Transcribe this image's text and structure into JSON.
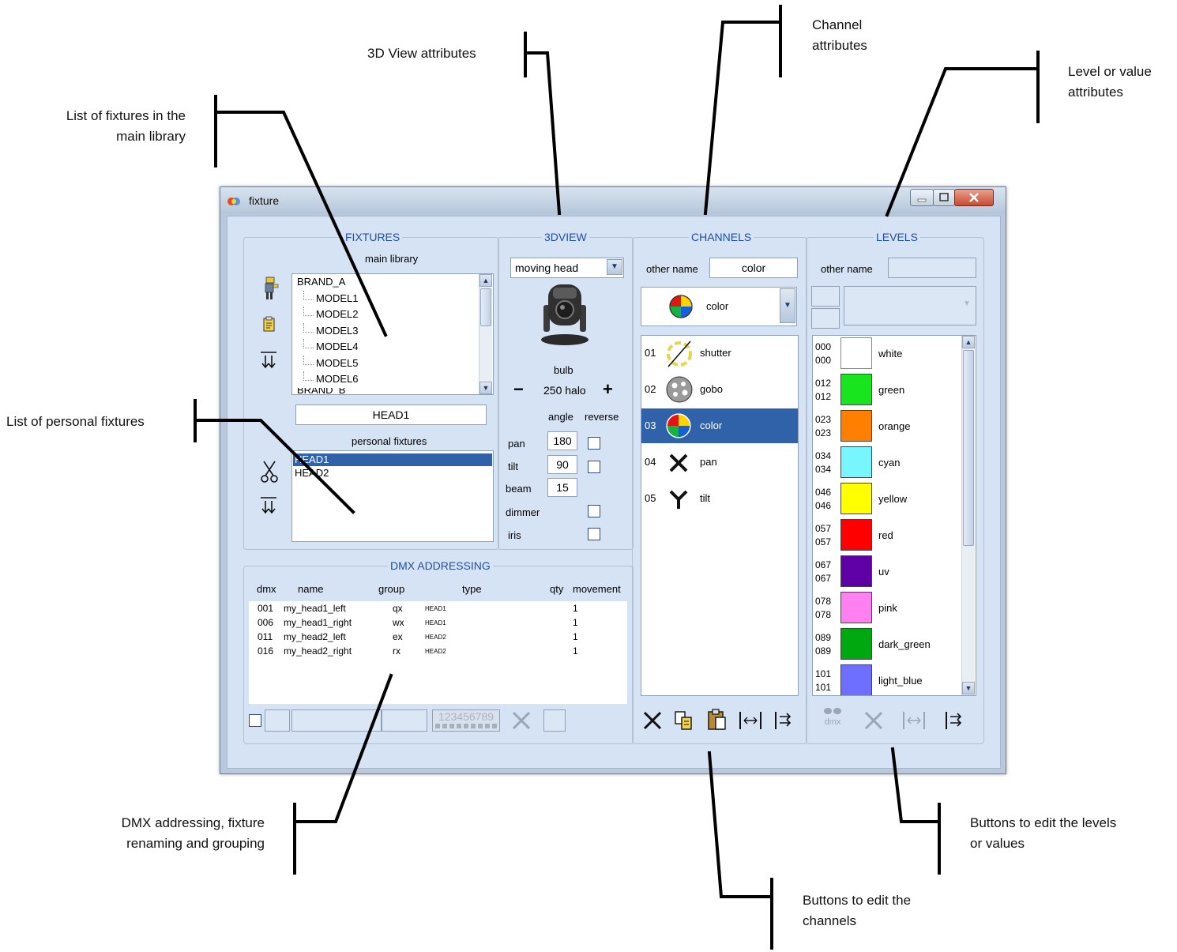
{
  "callouts": {
    "view3d": "3D View attributes",
    "channel": [
      "Channel",
      "attributes"
    ],
    "level": [
      "Level or value",
      "attributes"
    ],
    "main_library": [
      "List of fixtures in the",
      "main library"
    ],
    "personal": "List of personal fixtures",
    "dmx": [
      "DMX addressing, fixture",
      "renaming and grouping"
    ],
    "edit_levels": [
      "Buttons to edit the levels",
      "or values"
    ],
    "edit_channels": [
      "Buttons to edit the",
      "channels"
    ]
  },
  "window": {
    "title": "fixture"
  },
  "fixtures": {
    "title": "FIXTURES",
    "main_library_label": "main library",
    "tree": [
      "BRAND_A",
      "MODEL1",
      "MODEL2",
      "MODEL3",
      "MODEL4",
      "MODEL5",
      "MODEL6",
      "BRAND_B"
    ],
    "name_field": "HEAD1",
    "personal_label": "personal fixtures",
    "personal": [
      "HEAD1",
      "HEAD2"
    ],
    "icons": [
      "fixture-figure-icon",
      "document-icon",
      "move-down-icon",
      "scissors-icon",
      "move-down-icon"
    ]
  },
  "view3d": {
    "title": "3DVIEW",
    "type": "moving head",
    "bulb_label": "bulb",
    "minus": "−",
    "bulb": "250 halo",
    "plus": "+",
    "col_angle": "angle",
    "col_reverse": "reverse",
    "rows": [
      {
        "label": "pan",
        "angle": "180"
      },
      {
        "label": "tilt",
        "angle": "90"
      },
      {
        "label": "beam",
        "angle": "15"
      },
      {
        "label": "dimmer",
        "angle": ""
      },
      {
        "label": "iris",
        "angle": ""
      }
    ]
  },
  "channels": {
    "title": "CHANNELS",
    "other_name_label": "other name",
    "other_name": "color",
    "selected": "color",
    "list": [
      {
        "num": "01",
        "name": "shutter"
      },
      {
        "num": "02",
        "name": "gobo"
      },
      {
        "num": "03",
        "name": "color"
      },
      {
        "num": "04",
        "name": "pan"
      },
      {
        "num": "05",
        "name": "tilt"
      }
    ]
  },
  "levels": {
    "title": "LEVELS",
    "other_name_label": "other name",
    "other_name": "",
    "list": [
      {
        "a": "000",
        "b": "000",
        "name": "white",
        "color": "#ffffff"
      },
      {
        "a": "012",
        "b": "012",
        "name": "green",
        "color": "#19e51f"
      },
      {
        "a": "023",
        "b": "023",
        "name": "orange",
        "color": "#ff7f00"
      },
      {
        "a": "034",
        "b": "034",
        "name": "cyan",
        "color": "#77f7fd"
      },
      {
        "a": "046",
        "b": "046",
        "name": "yellow",
        "color": "#ffff00"
      },
      {
        "a": "057",
        "b": "057",
        "name": "red",
        "color": "#ff0000"
      },
      {
        "a": "067",
        "b": "067",
        "name": "uv",
        "color": "#5e00a6"
      },
      {
        "a": "078",
        "b": "078",
        "name": "pink",
        "color": "#ff80f0"
      },
      {
        "a": "089",
        "b": "089",
        "name": "dark_green",
        "color": "#00a80f"
      },
      {
        "a": "101",
        "b": "101",
        "name": "light_blue",
        "color": "#6f6fff"
      }
    ],
    "dmx_button": "dmx"
  },
  "dmx": {
    "title": "DMX ADDRESSING",
    "headers": [
      "dmx",
      "name",
      "group",
      "type",
      "qty",
      "movement"
    ],
    "rows": [
      {
        "dmx": "001",
        "name": "my_head1_left",
        "group": "qx",
        "type": "HEAD1",
        "qty": "1"
      },
      {
        "dmx": "006",
        "name": "my_head1_right",
        "group": "wx",
        "type": "HEAD1",
        "qty": "1"
      },
      {
        "dmx": "011",
        "name": "my_head2_left",
        "group": "ex",
        "type": "HEAD2",
        "qty": "1"
      },
      {
        "dmx": "016",
        "name": "my_head2_right",
        "group": "rx",
        "type": "HEAD2",
        "qty": "1"
      }
    ],
    "digits": "123456789"
  }
}
